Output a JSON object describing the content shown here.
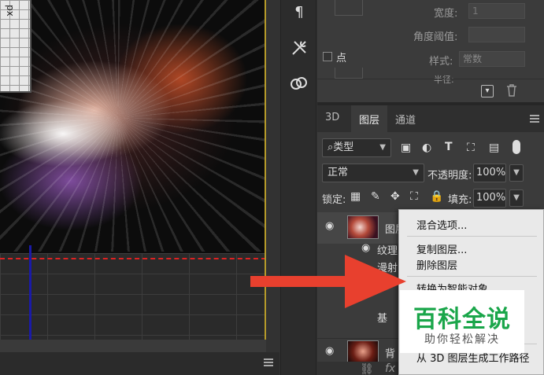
{
  "canvas": {
    "ruler_unit": "px"
  },
  "tools": {
    "paragraph_glyph": "¶"
  },
  "properties": {
    "width_label": "宽度:",
    "width_value": "1",
    "angle_label": "角度阈值:",
    "angle_value": "",
    "point_checkbox_label": "点",
    "style_label": "样式:",
    "style_value": "常数",
    "radius_label": "半径:"
  },
  "layers_panel": {
    "tabs": [
      {
        "label": "3D"
      },
      {
        "label": "图层"
      },
      {
        "label": "通道"
      }
    ],
    "filter_kind": "类型",
    "blend_mode": "正常",
    "opacity_label": "不透明度:",
    "opacity_value": "100%",
    "lock_label": "锁定:",
    "fill_label": "填充:",
    "fill_value": "100%",
    "layer1_name": "图层",
    "texture_label": "纹理",
    "diffuse_label": "漫射",
    "base_label": "基",
    "bg_layer_name": "背"
  },
  "context_menu": {
    "items": [
      {
        "label": "混合选项..."
      },
      {
        "label": "复制图层..."
      },
      {
        "label": "删除图层"
      },
      {
        "label": "转换为智能对象"
      },
      {
        "label": "从 3D 图层生成工作路径"
      }
    ]
  },
  "watermark": {
    "title": "百科全说",
    "subtitle": "助你轻松解决"
  },
  "colors": {
    "arrow": "#e8402e",
    "watermark_green": "#1aa64a",
    "guide_red": "#dd2222",
    "guide_blue": "#1a1aa8"
  }
}
